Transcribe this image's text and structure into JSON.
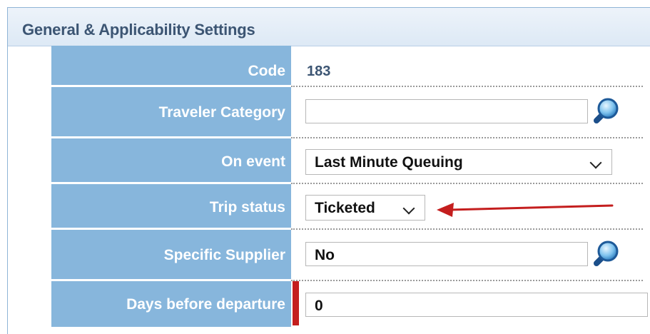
{
  "panel": {
    "title": "General & Applicability Settings"
  },
  "fields": {
    "code": {
      "label": "Code",
      "value": "183"
    },
    "traveler_category": {
      "label": "Traveler Category",
      "value": ""
    },
    "on_event": {
      "label": "On event",
      "value": "Last Minute Queuing"
    },
    "trip_status": {
      "label": "Trip status",
      "value": "Ticketed"
    },
    "specific_supplier": {
      "label": "Specific Supplier",
      "value": "No"
    },
    "days_before_departure": {
      "label": "Days before departure",
      "value": "0"
    }
  },
  "icons": {
    "lookup": "magnifier-icon",
    "dropdown": "chevron-down-icon"
  },
  "colors": {
    "label_bg": "#87b6dc",
    "header_text": "#3c5573",
    "annotation": "#c41e1e"
  }
}
